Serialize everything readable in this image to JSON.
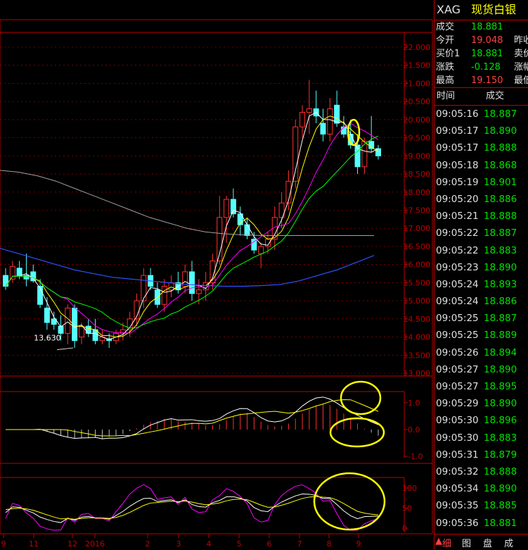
{
  "chart_data": {
    "type": "candlestick",
    "price_axis": {
      "ticks": [
        "22.000",
        "21.500",
        "21.000",
        "20.500",
        "20.000",
        "19.500",
        "19.000",
        "18.500",
        "18.000",
        "17.500",
        "17.000",
        "16.500",
        "16.000",
        "15.500",
        "15.000",
        "14.500",
        "14.000",
        "13.500",
        "13.000"
      ],
      "min": 13.0,
      "max": 22.0
    },
    "low_annotation": "13.630",
    "x_labels": [
      "9",
      "11",
      "12",
      "2016",
      "2",
      "3",
      "4",
      "5",
      "6",
      "7",
      "8",
      "9"
    ],
    "candles": [
      {
        "o": 15.7,
        "h": 15.9,
        "l": 15.3,
        "c": 15.4
      },
      {
        "o": 15.6,
        "h": 16.1,
        "l": 15.5,
        "c": 15.95
      },
      {
        "o": 15.9,
        "h": 16.1,
        "l": 15.6,
        "c": 15.7
      },
      {
        "o": 15.7,
        "h": 16.3,
        "l": 15.4,
        "c": 15.6
      },
      {
        "o": 15.8,
        "h": 16.0,
        "l": 15.5,
        "c": 15.55
      },
      {
        "o": 15.4,
        "h": 15.6,
        "l": 14.8,
        "c": 14.9
      },
      {
        "o": 14.8,
        "h": 15.1,
        "l": 14.2,
        "c": 14.4
      },
      {
        "o": 14.5,
        "h": 14.7,
        "l": 14.2,
        "c": 14.35
      },
      {
        "o": 14.3,
        "h": 14.6,
        "l": 13.9,
        "c": 14.1
      },
      {
        "o": 14.1,
        "h": 14.9,
        "l": 13.8,
        "c": 14.8
      },
      {
        "o": 14.8,
        "h": 14.9,
        "l": 13.7,
        "c": 13.9
      },
      {
        "o": 14.0,
        "h": 14.4,
        "l": 13.8,
        "c": 14.3
      },
      {
        "o": 14.3,
        "h": 14.5,
        "l": 14.0,
        "c": 14.1
      },
      {
        "o": 14.2,
        "h": 14.5,
        "l": 13.8,
        "c": 13.9
      },
      {
        "o": 13.9,
        "h": 14.2,
        "l": 13.8,
        "c": 14.0
      },
      {
        "o": 13.95,
        "h": 14.1,
        "l": 13.7,
        "c": 13.9
      },
      {
        "o": 13.9,
        "h": 14.2,
        "l": 13.8,
        "c": 14.1
      },
      {
        "o": 14.1,
        "h": 14.4,
        "l": 13.9,
        "c": 14.2
      },
      {
        "o": 14.2,
        "h": 14.7,
        "l": 14.0,
        "c": 14.5
      },
      {
        "o": 14.5,
        "h": 15.2,
        "l": 14.3,
        "c": 15.0
      },
      {
        "o": 15.0,
        "h": 15.9,
        "l": 14.8,
        "c": 15.7
      },
      {
        "o": 15.7,
        "h": 15.9,
        "l": 15.3,
        "c": 15.4
      },
      {
        "o": 15.3,
        "h": 15.5,
        "l": 14.8,
        "c": 14.9
      },
      {
        "o": 14.9,
        "h": 15.6,
        "l": 14.7,
        "c": 15.4
      },
      {
        "o": 15.3,
        "h": 15.7,
        "l": 15.1,
        "c": 15.5
      },
      {
        "o": 15.5,
        "h": 15.8,
        "l": 15.2,
        "c": 15.3
      },
      {
        "o": 15.4,
        "h": 16.0,
        "l": 15.2,
        "c": 15.8
      },
      {
        "o": 15.8,
        "h": 16.1,
        "l": 15.0,
        "c": 15.2
      },
      {
        "o": 15.2,
        "h": 15.6,
        "l": 14.9,
        "c": 15.3
      },
      {
        "o": 15.3,
        "h": 15.8,
        "l": 15.0,
        "c": 15.5
      },
      {
        "o": 15.5,
        "h": 16.3,
        "l": 15.3,
        "c": 16.1
      },
      {
        "o": 16.1,
        "h": 17.9,
        "l": 16.0,
        "c": 17.3
      },
      {
        "o": 17.3,
        "h": 17.9,
        "l": 16.6,
        "c": 17.8
      },
      {
        "o": 17.8,
        "h": 18.1,
        "l": 17.3,
        "c": 17.4
      },
      {
        "o": 17.4,
        "h": 17.6,
        "l": 16.8,
        "c": 17.1
      },
      {
        "o": 17.1,
        "h": 17.3,
        "l": 16.7,
        "c": 16.8
      },
      {
        "o": 16.7,
        "h": 16.9,
        "l": 16.3,
        "c": 16.4
      },
      {
        "o": 16.3,
        "h": 16.6,
        "l": 15.9,
        "c": 16.5
      },
      {
        "o": 16.5,
        "h": 16.9,
        "l": 16.3,
        "c": 16.7
      },
      {
        "o": 16.7,
        "h": 17.6,
        "l": 16.4,
        "c": 17.3
      },
      {
        "o": 17.3,
        "h": 18.0,
        "l": 17.0,
        "c": 17.7
      },
      {
        "o": 17.7,
        "h": 18.6,
        "l": 17.5,
        "c": 18.3
      },
      {
        "o": 18.3,
        "h": 20.0,
        "l": 18.1,
        "c": 19.8
      },
      {
        "o": 19.8,
        "h": 20.4,
        "l": 19.5,
        "c": 20.2
      },
      {
        "o": 20.2,
        "h": 21.1,
        "l": 19.6,
        "c": 20.3
      },
      {
        "o": 20.3,
        "h": 20.8,
        "l": 19.9,
        "c": 20.1
      },
      {
        "o": 19.9,
        "h": 20.3,
        "l": 19.4,
        "c": 19.6
      },
      {
        "o": 19.6,
        "h": 20.6,
        "l": 19.4,
        "c": 20.3
      },
      {
        "o": 20.4,
        "h": 20.8,
        "l": 19.8,
        "c": 19.9
      },
      {
        "o": 19.8,
        "h": 20.1,
        "l": 19.5,
        "c": 19.6
      },
      {
        "o": 19.6,
        "h": 20.0,
        "l": 19.2,
        "c": 19.3
      },
      {
        "o": 19.3,
        "h": 19.6,
        "l": 18.5,
        "c": 18.7
      },
      {
        "o": 18.7,
        "h": 19.5,
        "l": 18.5,
        "c": 19.4
      },
      {
        "o": 19.4,
        "h": 20.1,
        "l": 19.1,
        "c": 19.2
      },
      {
        "o": 19.2,
        "h": 19.3,
        "l": 18.9,
        "c": 19.0
      }
    ],
    "macd_axis": [
      "1.0",
      "0.0",
      "-1.0"
    ],
    "kdj_axis": [
      "100",
      "50",
      "0"
    ]
  },
  "quote": {
    "symbol": "XAG",
    "name": "现货白银",
    "rows": [
      {
        "label": "成交",
        "value": "18.881",
        "cls": "dn",
        "label2": ""
      },
      {
        "label": "今开",
        "value": "19.048",
        "cls": "up",
        "label2": "昨收"
      },
      {
        "label": "买价1",
        "value": "18.881",
        "cls": "dn",
        "label2": "卖价"
      },
      {
        "label": "涨跌",
        "value": "-0.128",
        "cls": "dn",
        "label2": "涨幅"
      },
      {
        "label": "最高",
        "value": "19.150",
        "cls": "up",
        "label2": "最低"
      }
    ],
    "ticks_header": {
      "time": "时间",
      "price": "成交"
    },
    "ticks": [
      {
        "t": "09:05:16",
        "p": "18.887"
      },
      {
        "t": "09:05:17",
        "p": "18.890"
      },
      {
        "t": "09:05:17",
        "p": "18.888"
      },
      {
        "t": "09:05:18",
        "p": "18.868"
      },
      {
        "t": "09:05:19",
        "p": "18.901"
      },
      {
        "t": "09:05:20",
        "p": "18.886"
      },
      {
        "t": "09:05:21",
        "p": "18.888"
      },
      {
        "t": "09:05:22",
        "p": "18.887"
      },
      {
        "t": "09:05:22",
        "p": "18.883"
      },
      {
        "t": "09:05:23",
        "p": "18.890"
      },
      {
        "t": "09:05:24",
        "p": "18.893"
      },
      {
        "t": "09:05:24",
        "p": "18.886"
      },
      {
        "t": "09:05:25",
        "p": "18.887"
      },
      {
        "t": "09:05:25",
        "p": "18.889"
      },
      {
        "t": "09:05:26",
        "p": "18.894"
      },
      {
        "t": "09:05:27",
        "p": "18.890"
      },
      {
        "t": "09:05:27",
        "p": "18.895"
      },
      {
        "t": "09:05:29",
        "p": "18.890"
      },
      {
        "t": "09:05:30",
        "p": "18.896"
      },
      {
        "t": "09:05:30",
        "p": "18.883"
      },
      {
        "t": "09:05:31",
        "p": "18.879"
      },
      {
        "t": "09:05:32",
        "p": "18.888"
      },
      {
        "t": "09:05:34",
        "p": "18.890"
      },
      {
        "t": "09:05:35",
        "p": "18.885"
      },
      {
        "t": "09:05:36",
        "p": "18.881"
      }
    ]
  },
  "tabs": [
    "细",
    "图",
    "盘",
    "成"
  ],
  "colors": {
    "up": "#ff4040",
    "down": "#00e000",
    "bull_candle": "#ff3030",
    "bear_candle": "#54ffff",
    "grid": "#c00000",
    "highlight": "#ffff00"
  }
}
